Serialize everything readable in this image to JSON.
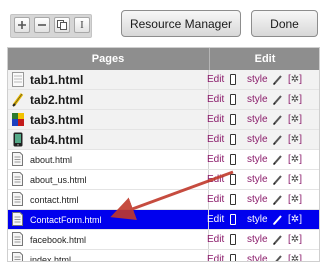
{
  "toolbar": {
    "add_icon": "plus-icon",
    "remove_icon": "minus-icon",
    "copy_icon": "copy-icon",
    "rename_label": "I",
    "resource_manager_label": "Resource Manager",
    "done_label": "Done"
  },
  "grid": {
    "columns": [
      "Pages",
      "Edit"
    ],
    "rows": [
      {
        "name": "tab1.html",
        "icon": "tab-blank-icon",
        "kind": "tab",
        "selected": false,
        "edit": "Edit",
        "style": "style"
      },
      {
        "name": "tab2.html",
        "icon": "tab-pencil-icon",
        "kind": "tab",
        "selected": false,
        "edit": "Edit",
        "style": "style"
      },
      {
        "name": "tab3.html",
        "icon": "tab-color-icon",
        "kind": "tab",
        "selected": false,
        "edit": "Edit",
        "style": "style"
      },
      {
        "name": "tab4.html",
        "icon": "tab-phone-icon",
        "kind": "tab",
        "selected": false,
        "edit": "Edit",
        "style": "style"
      },
      {
        "name": "about.html",
        "icon": "page-icon",
        "kind": "page",
        "selected": false,
        "edit": "Edit",
        "style": "style"
      },
      {
        "name": "about_us.html",
        "icon": "page-icon",
        "kind": "page",
        "selected": false,
        "edit": "Edit",
        "style": "style"
      },
      {
        "name": "contact.html",
        "icon": "page-icon",
        "kind": "page",
        "selected": false,
        "edit": "Edit",
        "style": "style"
      },
      {
        "name": "ContactForm.html",
        "icon": "page-icon",
        "kind": "page",
        "selected": true,
        "edit": "Edit",
        "style": "style"
      },
      {
        "name": "facebook.html",
        "icon": "page-icon",
        "kind": "page",
        "selected": false,
        "edit": "Edit",
        "style": "style"
      },
      {
        "name": "index.html",
        "icon": "page-icon",
        "kind": "page",
        "selected": false,
        "edit": "Edit",
        "style": "style"
      }
    ]
  },
  "colors": {
    "header_bg": "#8e8e8e",
    "selected_row": "#0000ee",
    "link": "#8a1a6a",
    "arrow": "#c0392b"
  }
}
